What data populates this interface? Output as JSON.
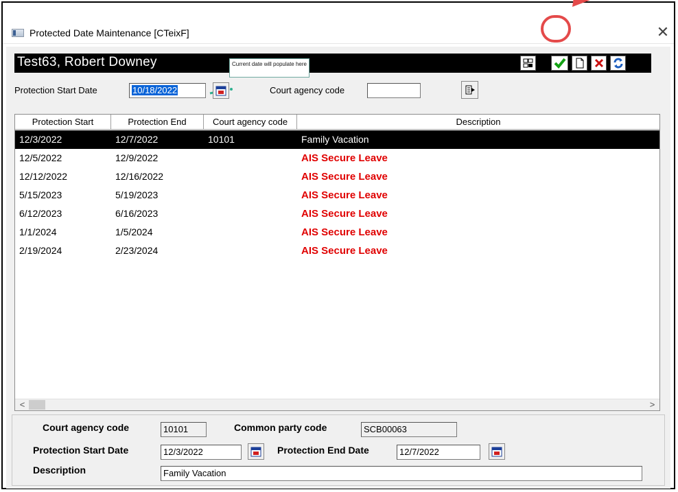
{
  "window": {
    "title": "Protected Date Maintenance [CTeixF]",
    "close_glyph": "✕"
  },
  "header": {
    "client_name": "Test63, Robert Downey",
    "tooltip": "Current date will populate here"
  },
  "toolbar": {
    "buttons": [
      {
        "name": "grid-icon"
      },
      {
        "name": "check-icon"
      },
      {
        "name": "new-document-icon"
      },
      {
        "name": "delete-x-icon"
      },
      {
        "name": "refresh-icon"
      }
    ],
    "accent_color": "#e44a4a"
  },
  "filter": {
    "start_label": "Protection Start Date",
    "start_value": "10/18/2022",
    "court_label": "Court agency code",
    "court_value": ""
  },
  "grid": {
    "columns": [
      "Protection Start",
      "Protection End",
      "Court agency code",
      "Description"
    ],
    "rows": [
      {
        "start": "12/3/2022",
        "end": "12/7/2022",
        "court": "10101",
        "desc": "Family Vacation",
        "selected": true
      },
      {
        "start": "12/5/2022",
        "end": "12/9/2022",
        "court": "",
        "desc": "AIS Secure Leave"
      },
      {
        "start": "12/12/2022",
        "end": "12/16/2022",
        "court": "",
        "desc": "AIS Secure Leave"
      },
      {
        "start": "5/15/2023",
        "end": "5/19/2023",
        "court": "",
        "desc": "AIS Secure Leave"
      },
      {
        "start": "6/12/2023",
        "end": "6/16/2023",
        "court": "",
        "desc": "AIS Secure Leave"
      },
      {
        "start": "1/1/2024",
        "end": "1/5/2024",
        "court": "",
        "desc": "AIS Secure Leave"
      },
      {
        "start": "2/19/2024",
        "end": "2/23/2024",
        "court": "",
        "desc": "AIS Secure Leave"
      }
    ],
    "scroll_left": "<",
    "scroll_right": ">"
  },
  "detail": {
    "court_label": "Court agency code",
    "court_value": "10101",
    "party_label": "Common party code",
    "party_value": "SCB00063",
    "start_label": "Protection Start Date",
    "start_value": "12/3/2022",
    "end_label": "Protection End Date",
    "end_value": "12/7/2022",
    "desc_label": "Description",
    "desc_value": "Family Vacation"
  }
}
